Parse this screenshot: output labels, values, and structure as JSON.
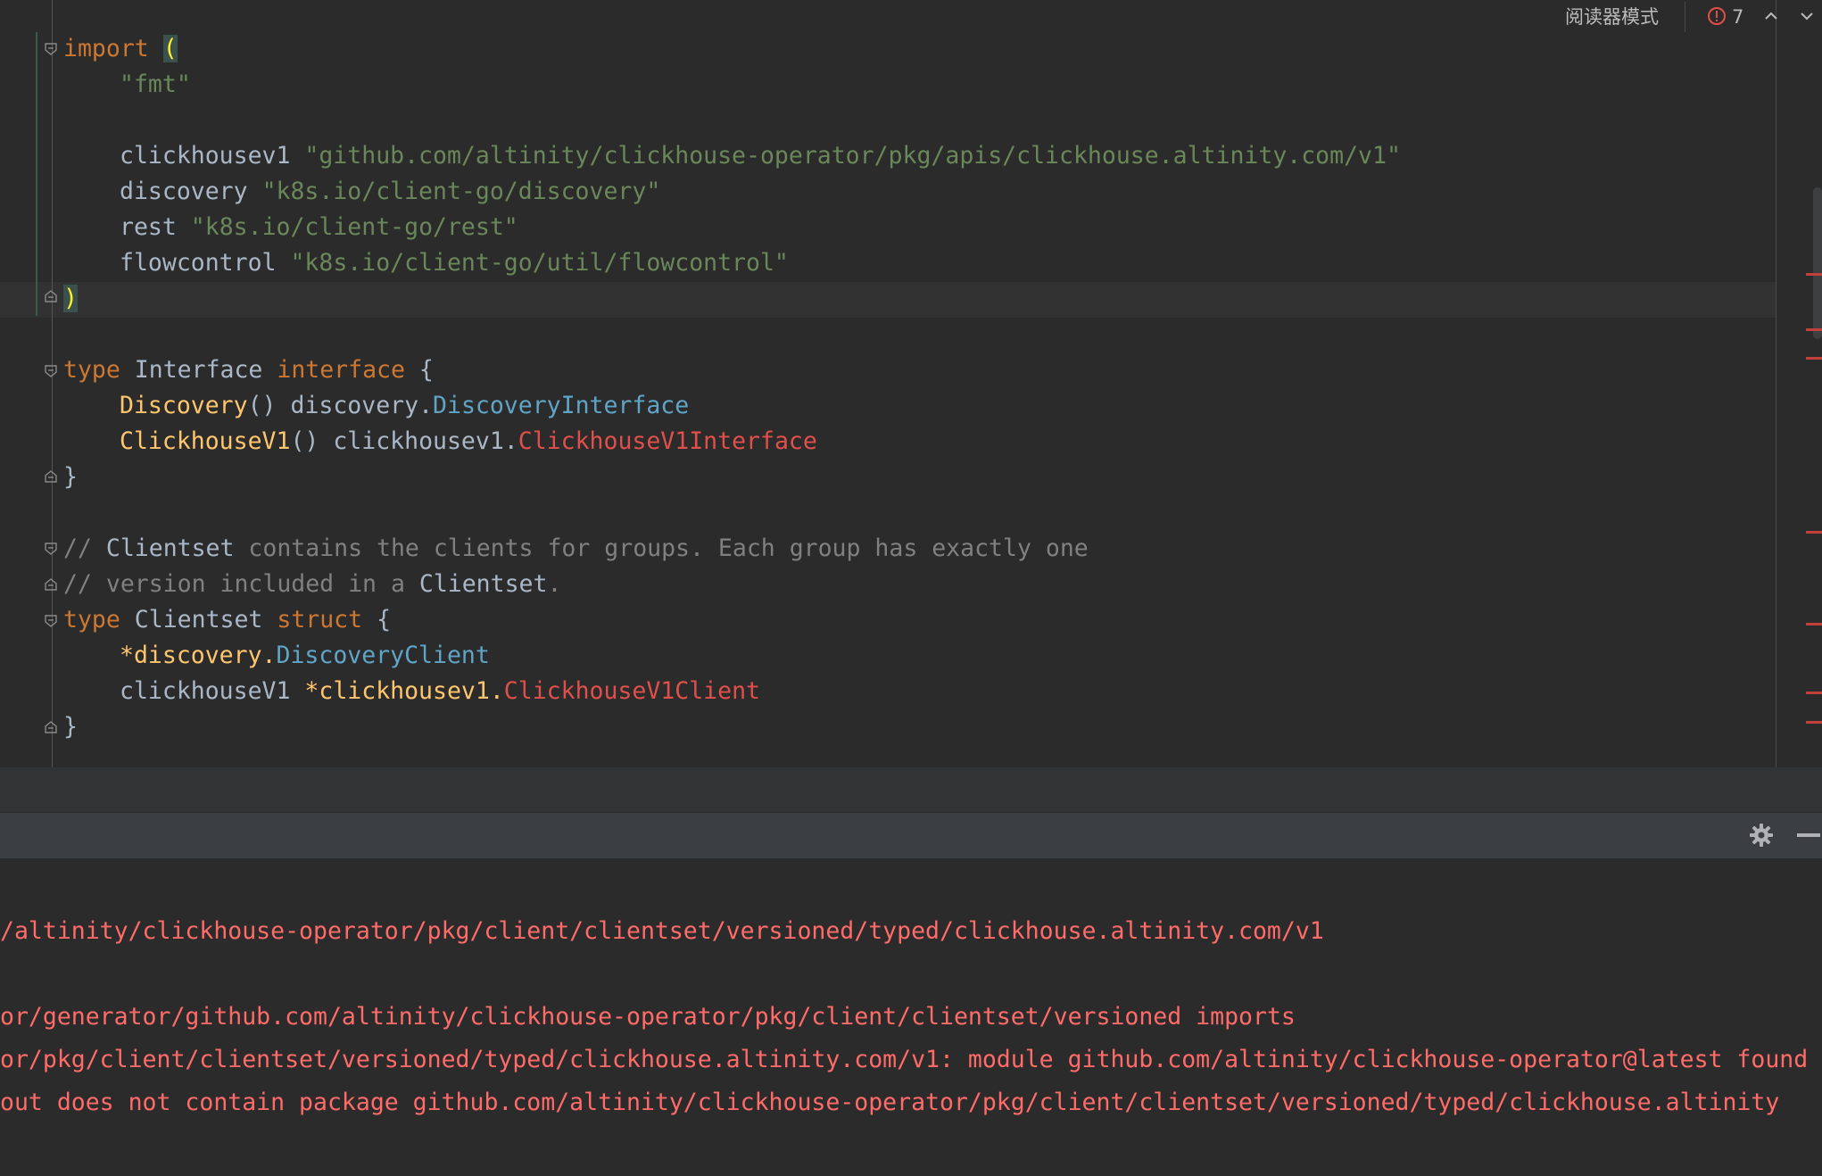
{
  "toolbar": {
    "reader_mode_label": "阅读器模式",
    "error_count": "7",
    "error_icon": "error-circle-icon",
    "prev_icon": "chevron-up-icon",
    "next_icon": "chevron-down-icon"
  },
  "code": {
    "import_kw": "import",
    "import_open": "(",
    "fmt_str": "\"fmt\"",
    "alias_clickhousev1": "clickhousev1",
    "path_clickhousev1": "\"github.com/altinity/clickhouse-operator/pkg/apis/clickhouse.altinity.com/v1\"",
    "alias_discovery": "discovery",
    "path_discovery": "\"k8s.io/client-go/discovery\"",
    "alias_rest": "rest",
    "path_rest": "\"k8s.io/client-go/rest\"",
    "alias_flowcontrol": "flowcontrol",
    "path_flowcontrol": "\"k8s.io/client-go/util/flowcontrol\"",
    "import_close": ")",
    "type_kw": "type",
    "interface_name": "Interface",
    "interface_kw": "interface",
    "open_brace": "{",
    "close_brace": "}",
    "discovery_method": "Discovery",
    "parens": "()",
    "discovery_pkg": "discovery.",
    "discovery_iface": "DiscoveryInterface",
    "chv1_method": "ClickhouseV1",
    "chv1_pkg": "clickhousev1.",
    "chv1_iface": "ClickhouseV1Interface",
    "comment1_a": "// ",
    "comment1_word": "Clientset",
    "comment1_b": " contains the clients for groups. Each group has exactly one",
    "comment2_a": "// version included in a ",
    "comment2_word": "Clientset",
    "comment2_b": ".",
    "clientset_name": "Clientset",
    "struct_kw": "struct",
    "field1_prefix": "*discovery.",
    "field1_type": "DiscoveryClient",
    "field2_name": "clickhouseV1 ",
    "field2_prefix": "*clickhousev1.",
    "field2_type": "ClickhouseV1Client"
  },
  "tool_window": {
    "settings_icon": "gear-icon",
    "minimize_icon": "minimize-icon"
  },
  "console": {
    "lines": [
      "/altinity/clickhouse-operator/pkg/client/clientset/versioned/typed/clickhouse.altinity.com/v1",
      "or/generator/github.com/altinity/clickhouse-operator/pkg/client/clientset/versioned imports",
      "or/pkg/client/clientset/versioned/typed/clickhouse.altinity.com/v1: module github.com/altinity/clickhouse-operator@latest found",
      "out does not contain package github.com/altinity/clickhouse-operator/pkg/client/clientset/versioned/typed/clickhouse.altinity"
    ]
  },
  "colors": {
    "editor_bg": "#2b2b2b",
    "keyword": "#cc7832",
    "string": "#6a8759",
    "function": "#ffc66d",
    "type_resolved": "#5fa5c7",
    "type_unresolved": "#e0504a",
    "comment": "#808080",
    "console_error": "#ff6b68"
  }
}
